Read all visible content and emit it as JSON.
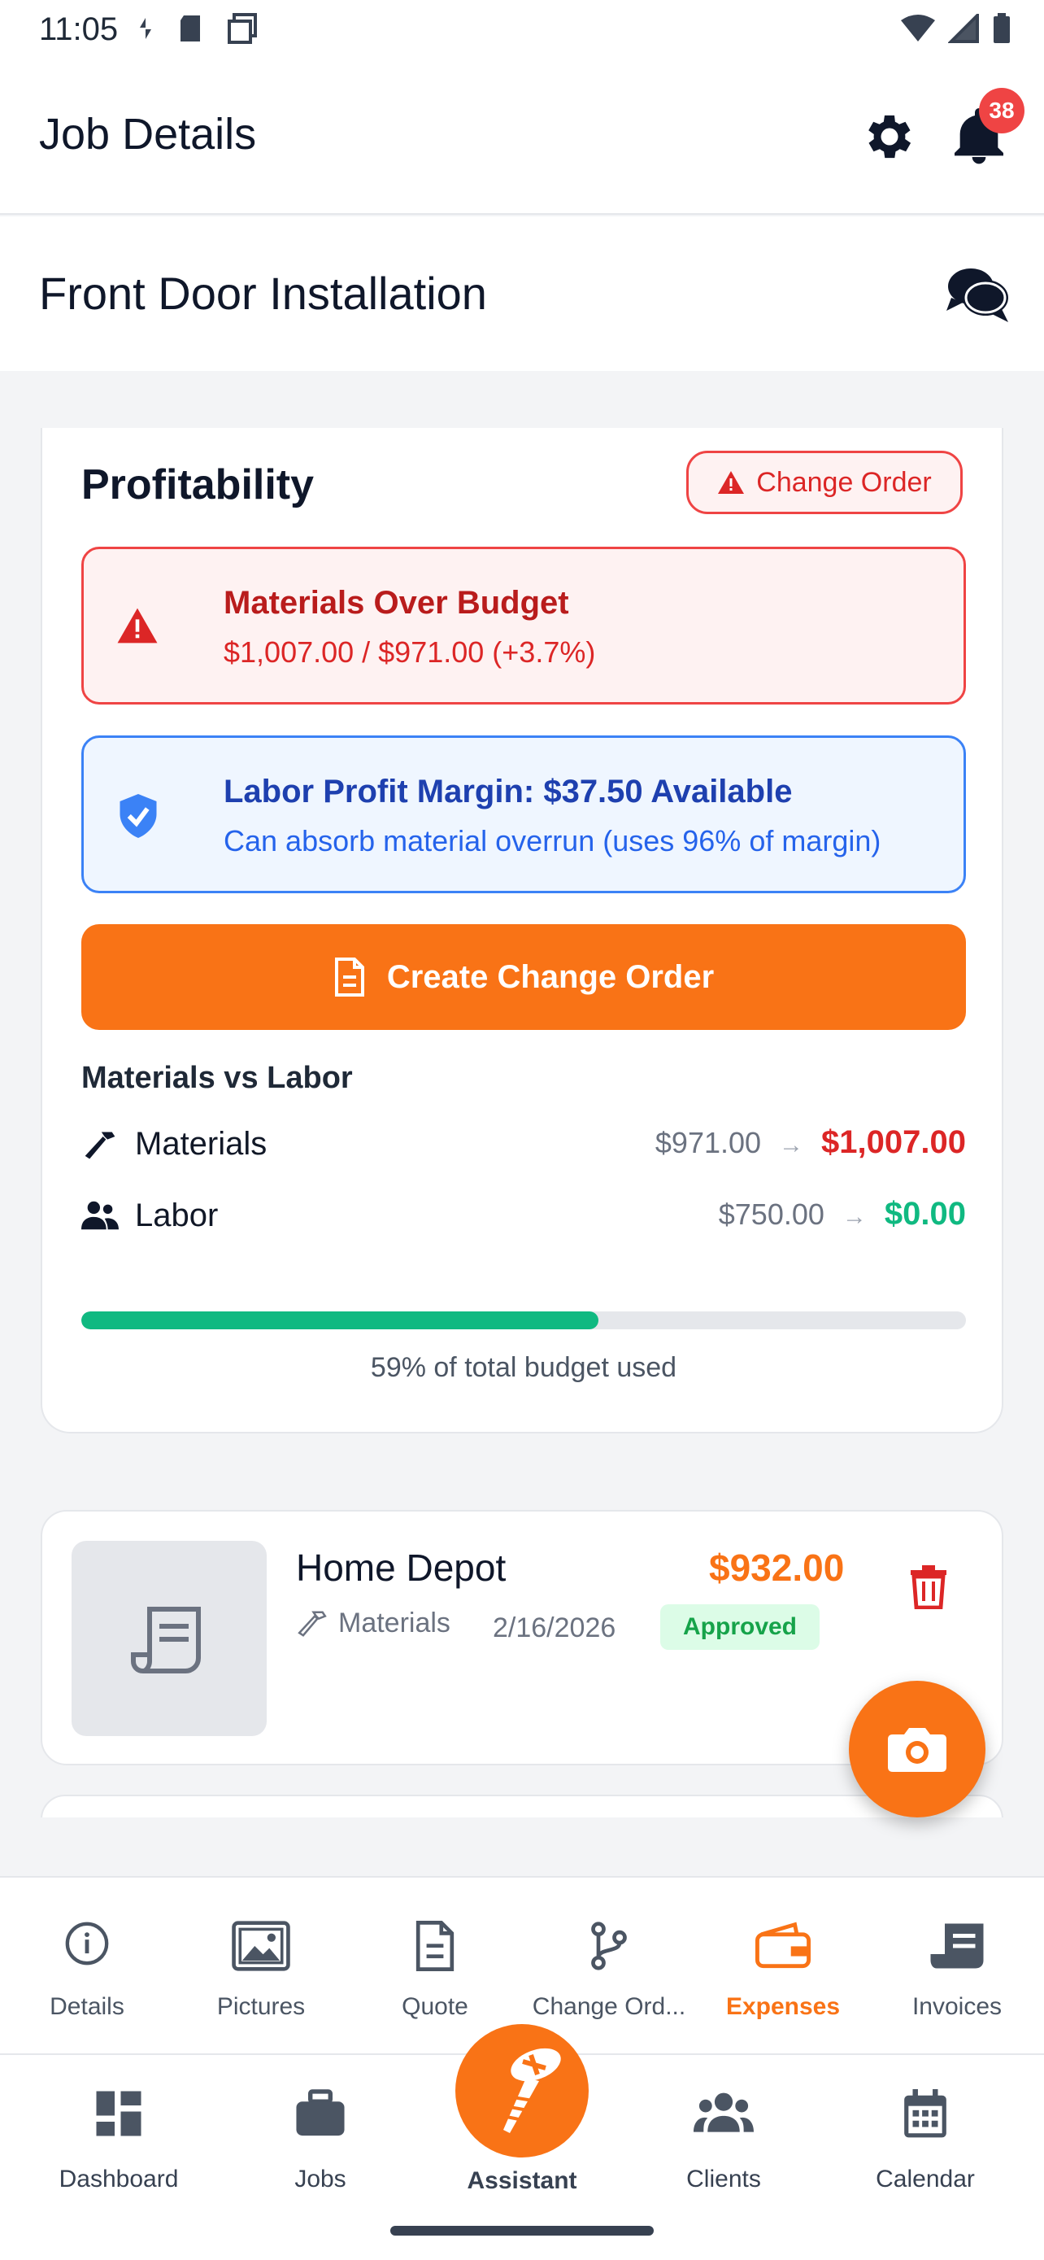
{
  "status_bar": {
    "time": "11:05"
  },
  "header": {
    "title": "Job Details",
    "notification_count": "38"
  },
  "job": {
    "title": "Front Door Installation"
  },
  "profitability": {
    "title": "Profitability",
    "change_order_pill": "Change Order",
    "alert_materials": {
      "title": "Materials Over Budget",
      "detail": "$1,007.00 / $971.00 (+3.7%)"
    },
    "alert_labor": {
      "title": "Labor Profit Margin: $37.50 Available",
      "detail": "Can absorb material overrun (uses 96% of margin)"
    },
    "create_button": "Create Change Order",
    "comparison": {
      "title": "Materials vs Labor",
      "arrow": "→",
      "rows": [
        {
          "label": "Materials",
          "budget": "$971.00",
          "actual": "$1,007.00",
          "actual_color": "#dc2626"
        },
        {
          "label": "Labor",
          "budget": "$750.00",
          "actual": "$0.00",
          "actual_color": "#10b981"
        }
      ]
    },
    "budget_used_fraction": 0.585,
    "budget_caption": "59% of total budget used"
  },
  "expense": {
    "vendor": "Home Depot",
    "amount": "$932.00",
    "category": "Materials",
    "date": "2/16/2026",
    "status": "Approved"
  },
  "job_tabs": [
    {
      "label": "Details",
      "icon": "info-icon",
      "active": false
    },
    {
      "label": "Pictures",
      "icon": "pictures-icon",
      "active": false
    },
    {
      "label": "Quote",
      "icon": "document-icon",
      "active": false
    },
    {
      "label": "Change Ord...",
      "icon": "branch-icon",
      "active": true
    },
    {
      "label": "Expenses",
      "icon": "wallet-icon",
      "active": true
    },
    {
      "label": "Invoices",
      "icon": "invoice-icon",
      "active": false
    }
  ],
  "main_nav": {
    "dashboard": "Dashboard",
    "jobs": "Jobs",
    "assistant": "Assistant",
    "clients": "Clients",
    "calendar": "Calendar"
  },
  "colors": {
    "accent": "#f97316",
    "danger": "#ef4444",
    "info": "#3b82f6",
    "success": "#10b981"
  }
}
